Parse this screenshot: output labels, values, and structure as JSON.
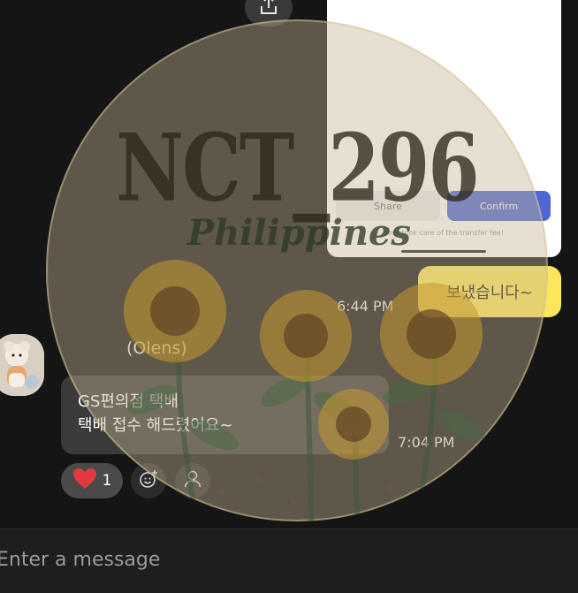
{
  "screenshot_card": {
    "share_label": "Share",
    "confirm_label": "Confirm",
    "note": "Toss took care of the transfer fee!"
  },
  "messages": {
    "sent": {
      "text": "보냈습니다~",
      "time": "6:44 PM"
    },
    "received": {
      "sender": "(Olens)",
      "lines": [
        "GS편의점 택배",
        "택배 접수 해드렸어요~"
      ],
      "time": "7:04 PM",
      "reaction_count": "1"
    }
  },
  "composer": {
    "placeholder": "Enter a message"
  },
  "watermark": {
    "title": "NCT_296",
    "subtitle": "Philippines"
  },
  "colors": {
    "background": "#151515",
    "sent_bubble": "#fde65a",
    "received_bubble": "#3b3b3b",
    "confirm_button": "#4e67d6",
    "heart": "#e0393e"
  },
  "icons": [
    "share-icon",
    "heart-icon",
    "add-reaction-icon",
    "person-icon"
  ]
}
